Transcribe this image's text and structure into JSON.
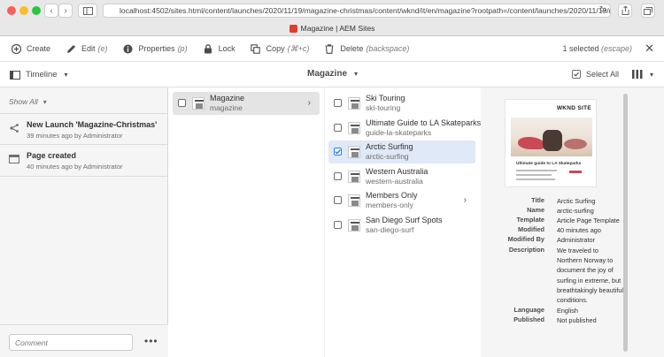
{
  "browser": {
    "address": "localhost:4502/sites.html/content/launches/2020/11/19/magazine-christmas/content/wknd/it/en/magazine?rootpath=/content/launches/2020/11/19/ma",
    "tab_title": "Magazine | AEM Sites"
  },
  "actionbar": {
    "actions": [
      {
        "label": "Create",
        "shortcut": "",
        "icon": "add-circle-icon"
      },
      {
        "label": "Edit",
        "shortcut": "(e)",
        "icon": "pencil-icon"
      },
      {
        "label": "Properties",
        "shortcut": "(p)",
        "icon": "info-icon"
      },
      {
        "label": "Lock",
        "shortcut": "",
        "icon": "lock-icon"
      },
      {
        "label": "Copy",
        "shortcut": "(⌘+c)",
        "icon": "copy-icon"
      },
      {
        "label": "Delete",
        "shortcut": "(backspace)",
        "icon": "trash-icon"
      }
    ],
    "selection_count": "1 selected",
    "selection_hint": "(escape)"
  },
  "subheader": {
    "rail_selector": "Timeline",
    "title": "Magazine",
    "select_all": "Select All"
  },
  "timeline": {
    "filter": "Show All",
    "events": [
      {
        "title": "New Launch 'Magazine-Christmas'",
        "meta": "39 minutes ago by Administrator",
        "icon": "launch-icon"
      },
      {
        "title": "Page created",
        "meta": "40 minutes ago by Administrator",
        "icon": "page-icon"
      }
    ],
    "comment_placeholder": "Comment",
    "more": "•••"
  },
  "column1": {
    "items": [
      {
        "title": "Magazine",
        "name": "magazine",
        "has_children": true
      }
    ]
  },
  "column2": {
    "items": [
      {
        "title": "Ski Touring",
        "name": "ski-touring",
        "selected": false,
        "has_children": false
      },
      {
        "title": "Ultimate Guide to LA Skateparks",
        "name": "guide-la-skateparks",
        "selected": false,
        "has_children": false
      },
      {
        "title": "Arctic Surfing",
        "name": "arctic-surfing",
        "selected": true,
        "has_children": false
      },
      {
        "title": "Western Australia",
        "name": "western-australia",
        "selected": false,
        "has_children": false
      },
      {
        "title": "Members Only",
        "name": "members-only",
        "selected": false,
        "has_children": true
      },
      {
        "title": "San Diego Surf Spots",
        "name": "san-diego-surf",
        "selected": false,
        "has_children": false
      }
    ]
  },
  "preview": {
    "logo": "WKND SITE",
    "caption": "Ultimate guide to LA Skateparks",
    "properties": [
      {
        "key": "Title",
        "value": "Arctic Surfing"
      },
      {
        "key": "Name",
        "value": "arctic-surfing"
      },
      {
        "key": "Template",
        "value": "Article Page Template"
      },
      {
        "key": "Modified",
        "value": "40 minutes ago"
      },
      {
        "key": "Modified By",
        "value": "Administrator"
      },
      {
        "key": "Description",
        "value": "We traveled to Northern Norway to document the joy of surfing in extreme, but breathtakingly beautiful conditions."
      },
      {
        "key": "Language",
        "value": "English"
      },
      {
        "key": "Published",
        "value": "Not published"
      }
    ]
  },
  "colors": {
    "selected_row": "#dfe9f7",
    "checkbox_blue": "#2680eb",
    "rail_bg": "#f5f5f5"
  }
}
